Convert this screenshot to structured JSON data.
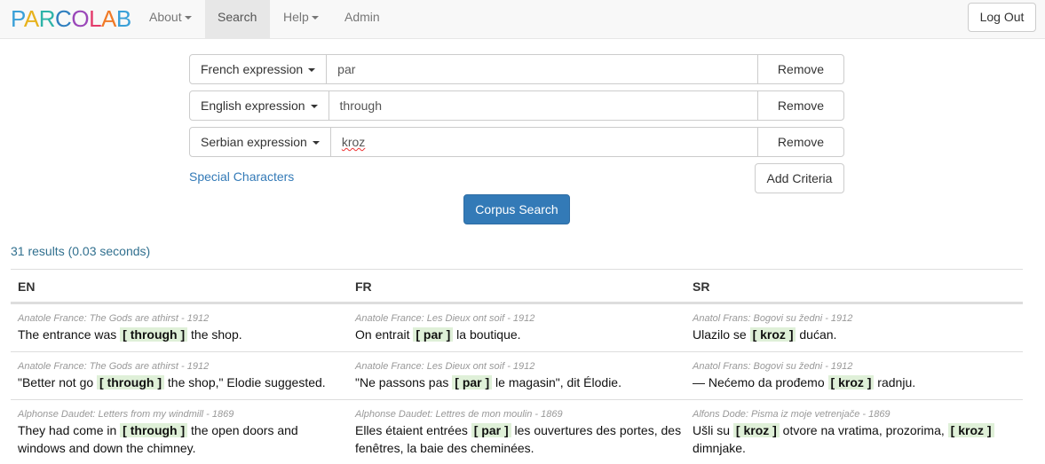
{
  "navbar": {
    "brand_letters": [
      {
        "char": "P",
        "color": "#3aa0d8"
      },
      {
        "char": "A",
        "color": "#e7b21d"
      },
      {
        "char": "R",
        "color": "#2db3a8"
      },
      {
        "char": "C",
        "color": "#2f7fbf"
      },
      {
        "char": "O",
        "color": "#9a47b9"
      },
      {
        "char": "L",
        "color": "#e33b6b"
      },
      {
        "char": "A",
        "color": "#f07a28"
      },
      {
        "char": "B",
        "color": "#3aa0d8"
      }
    ],
    "about": "About",
    "search": "Search",
    "help": "Help",
    "admin": "Admin",
    "logout": "Log Out"
  },
  "criteria": [
    {
      "language": "French expression",
      "value": "par",
      "remove": "Remove"
    },
    {
      "language": "English expression",
      "value": "through",
      "remove": "Remove"
    },
    {
      "language": "Serbian expression",
      "value": "kroz",
      "remove": "Remove"
    }
  ],
  "special_characters": "Special Characters",
  "add_criteria": "Add Criteria",
  "corpus_search": "Corpus Search",
  "results_count": "31 results (0.03 seconds)",
  "table": {
    "headers": [
      "EN",
      "FR",
      "SR"
    ],
    "rows": [
      {
        "en": {
          "source": "Anatole France: The Gods are athirst - 1912",
          "before": "The entrance was ",
          "hl": "[ through ]",
          "after": " the shop.",
          "hl2": "",
          "after2": ""
        },
        "fr": {
          "source": "Anatole France: Les Dieux ont soif - 1912",
          "before": "On entrait ",
          "hl": "[ par ]",
          "after": " la boutique.",
          "hl2": "",
          "after2": ""
        },
        "sr": {
          "source": "Anatol Frans: Bogovi su žedni - 1912",
          "before": "Ulazilo se ",
          "hl": "[ kroz ]",
          "after": " dućan.",
          "hl2": "",
          "after2": ""
        }
      },
      {
        "en": {
          "source": "Anatole France: The Gods are athirst - 1912",
          "before": "\"Better not go ",
          "hl": "[ through ]",
          "after": " the shop,\" Elodie suggested.",
          "hl2": "",
          "after2": ""
        },
        "fr": {
          "source": "Anatole France: Les Dieux ont soif - 1912",
          "before": "\"Ne passons pas ",
          "hl": "[ par ]",
          "after": " le magasin\", dit Élodie.",
          "hl2": "",
          "after2": ""
        },
        "sr": {
          "source": "Anatol Frans: Bogovi su žedni - 1912",
          "before": "— Nećemo da prođemo ",
          "hl": "[ kroz ]",
          "after": " radnju.",
          "hl2": "",
          "after2": ""
        }
      },
      {
        "en": {
          "source": "Alphonse Daudet: Letters from my windmill - 1869",
          "before": "They had come in ",
          "hl": "[ through ]",
          "after": " the open doors and windows and down the chimney.",
          "hl2": "",
          "after2": ""
        },
        "fr": {
          "source": "Alphonse Daudet: Lettres de mon moulin - 1869",
          "before": "Elles étaient entrées ",
          "hl": "[ par ]",
          "after": " les ouvertures des portes, des fenêtres, la baie des cheminées.",
          "hl2": "",
          "after2": ""
        },
        "sr": {
          "source": "Alfons Dode: Pisma iz moje vetrenjače - 1869",
          "before": "Ušli su ",
          "hl": "[ kroz ]",
          "after": " otvore na vratima, prozorima, ",
          "hl2": "[ kroz ]",
          "after2": " dimnjake."
        }
      }
    ]
  }
}
